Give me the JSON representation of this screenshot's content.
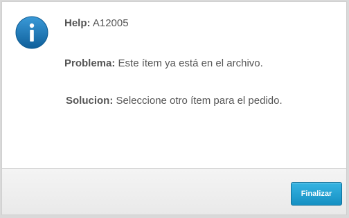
{
  "dialog": {
    "icon": "info-icon",
    "help_label": "Help:",
    "help_value": "A12005",
    "problema_label": "Problema:",
    "problema_value": "Este ítem ya está en el archivo.",
    "solucion_label": "Solucion:",
    "solucion_value": "Seleccione otro ítem para el pedido."
  },
  "footer": {
    "finalizar_label": "Finalizar"
  },
  "colors": {
    "icon_blue": "#1b75b4",
    "button_blue": "#1f9fd3",
    "text": "#555555"
  }
}
